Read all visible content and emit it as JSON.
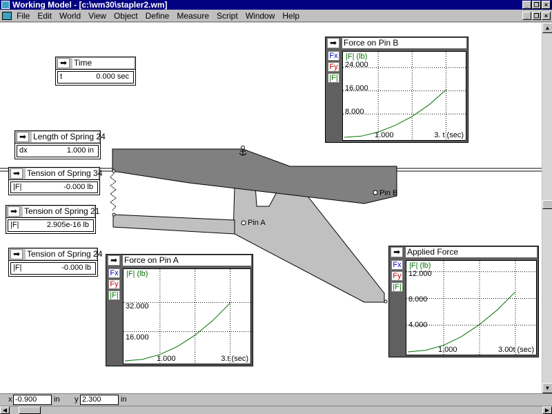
{
  "window": {
    "title": "Working Model - [c:\\wm30\\stapler2.wm]"
  },
  "menu": {
    "items": [
      "File",
      "Edit",
      "World",
      "View",
      "Object",
      "Define",
      "Measure",
      "Script",
      "Window",
      "Help"
    ]
  },
  "icons": {
    "meter_button": "right-arrow-icon",
    "minimize": "minimize-icon",
    "restore": "restore-icon",
    "close": "close-icon",
    "anchor": "anchor-icon"
  },
  "meters": {
    "time": {
      "title": "Time",
      "var": "t",
      "value": "0.000 sec"
    },
    "length24": {
      "title": "Length of Spring 24",
      "var": "dx",
      "value": "1.000 in"
    },
    "tension34": {
      "title": "Tension of Spring 34",
      "var": "|F|",
      "value": "-0.000 lb"
    },
    "tension21": {
      "title": "Tension of Spring 21",
      "var": "|F|",
      "value": "2.905e-16 lb"
    },
    "tension24": {
      "title": "Tension of Spring 24",
      "var": "|F|",
      "value": "-0.000 lb"
    }
  },
  "legend": {
    "fx": "Fx",
    "fy": "Fy",
    "f": "|F|"
  },
  "colors": {
    "fx": "#0000c0",
    "fy": "#c00000",
    "f": "#007000",
    "curve": "#007000"
  },
  "chart_data": [
    {
      "type": "line",
      "title": "Force on Pin B",
      "ylabel": "|F| (lb)",
      "xlabel": "t (sec)",
      "x_ticks": [
        "1.000"
      ],
      "x_max_label": "3.",
      "y_ticks": [
        "24.000",
        "16.000",
        "8.000"
      ],
      "xlim": [
        0,
        3.5
      ],
      "ylim": [
        0,
        28
      ],
      "series": [
        {
          "values": [
            [
              0,
              0
            ],
            [
              0.5,
              0.4
            ],
            [
              1,
              1.8
            ],
            [
              1.5,
              4.1
            ],
            [
              2,
              7.2
            ],
            [
              2.5,
              11.2
            ],
            [
              3,
              16.3
            ]
          ]
        }
      ]
    },
    {
      "type": "line",
      "title": "Force on Pin A",
      "ylabel": "|F| (lb)",
      "xlabel": "t (sec)",
      "x_ticks": [
        "1.000"
      ],
      "x_max_label": "3.",
      "y_ticks": [
        "32.000",
        "16.000"
      ],
      "xlim": [
        0,
        3.5
      ],
      "ylim": [
        0,
        48
      ],
      "series": [
        {
          "values": [
            [
              0,
              0
            ],
            [
              0.5,
              0.8
            ],
            [
              1,
              3.5
            ],
            [
              1.5,
              7.9
            ],
            [
              2,
              14.1
            ],
            [
              2.5,
              22.0
            ],
            [
              3,
              31.7
            ]
          ]
        }
      ]
    },
    {
      "type": "line",
      "title": "Applied Force",
      "ylabel": "|F| (lb)",
      "xlabel": "t (sec)",
      "x_ticks": [
        "1.000"
      ],
      "x_max_label": "3.00",
      "y_ticks": [
        "12.000",
        "8.000",
        "4.000"
      ],
      "xlim": [
        0,
        3.5
      ],
      "ylim": [
        0,
        13
      ],
      "series": [
        {
          "values": [
            [
              0,
              0
            ],
            [
              0.5,
              0.25
            ],
            [
              1,
              1.0
            ],
            [
              1.5,
              2.3
            ],
            [
              2,
              4.1
            ],
            [
              2.5,
              6.3
            ],
            [
              3,
              9.0
            ]
          ]
        }
      ]
    }
  ],
  "scene": {
    "pin_a": "Pin A",
    "pin_b": "Pin B"
  },
  "status": {
    "x_label": "x",
    "x_value": "-0.900",
    "y_label": "y",
    "y_value": "2.300",
    "unit": "in"
  }
}
